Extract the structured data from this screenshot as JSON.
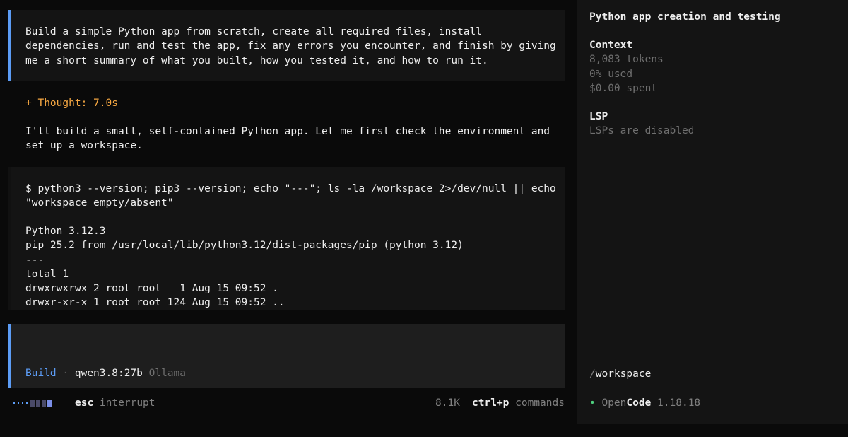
{
  "messages": {
    "user_prompt": "Build a simple Python app from scratch, create all required files, install\ndependencies, run and test the app, fix any errors you encounter, and finish by giving\nme a short summary of what you built, how you tested it, and how to run it.",
    "thought_label": "+ Thought: 7.0s",
    "assistant_text": "I'll build a small, self-contained Python app. Let me first check the environment and\nset up a workspace.",
    "tool_command": "$ python3 --version; pip3 --version; echo \"---\"; ls -la /workspace 2>/dev/null || echo\n\"workspace empty/absent\"",
    "tool_output": "Python 3.12.3\npip 25.2 from /usr/local/lib/python3.12/dist-packages/pip (python 3.12)\n---\ntotal 1\ndrwxrwxrwx 2 root root   1 Aug 15 09:52 .\ndrwxr-xr-x 1 root root 124 Aug 15 09:52 .."
  },
  "prompt": {
    "value": "",
    "placeholder": "",
    "mode": "Build",
    "separator": "·",
    "model": "qwen3.8:27b",
    "provider": "Ollama"
  },
  "status": {
    "esc_key": "esc",
    "esc_action": "interrupt",
    "tokens": "8.1K",
    "cmd_key": "ctrl+p",
    "cmd_label": "commands"
  },
  "sidebar": {
    "title": "Python app creation and testing",
    "context": {
      "heading": "Context",
      "tokens": "8,083 tokens",
      "used": "0% used",
      "spent": "$0.00 spent"
    },
    "lsp": {
      "heading": "LSP",
      "status": "LSPs are disabled"
    },
    "cwd_slash": "/",
    "cwd_name": "workspace",
    "brand": {
      "bullet": "•",
      "open": "Open",
      "code": "Code",
      "version": "1.18.18"
    }
  },
  "colors": {
    "accent": "#5c9cf5",
    "thought": "#f5a742",
    "status_ok": "#4fd07f"
  },
  "icons": {
    "spinner": "loading-spinner-icon",
    "status_dot": "status-dot-icon"
  }
}
